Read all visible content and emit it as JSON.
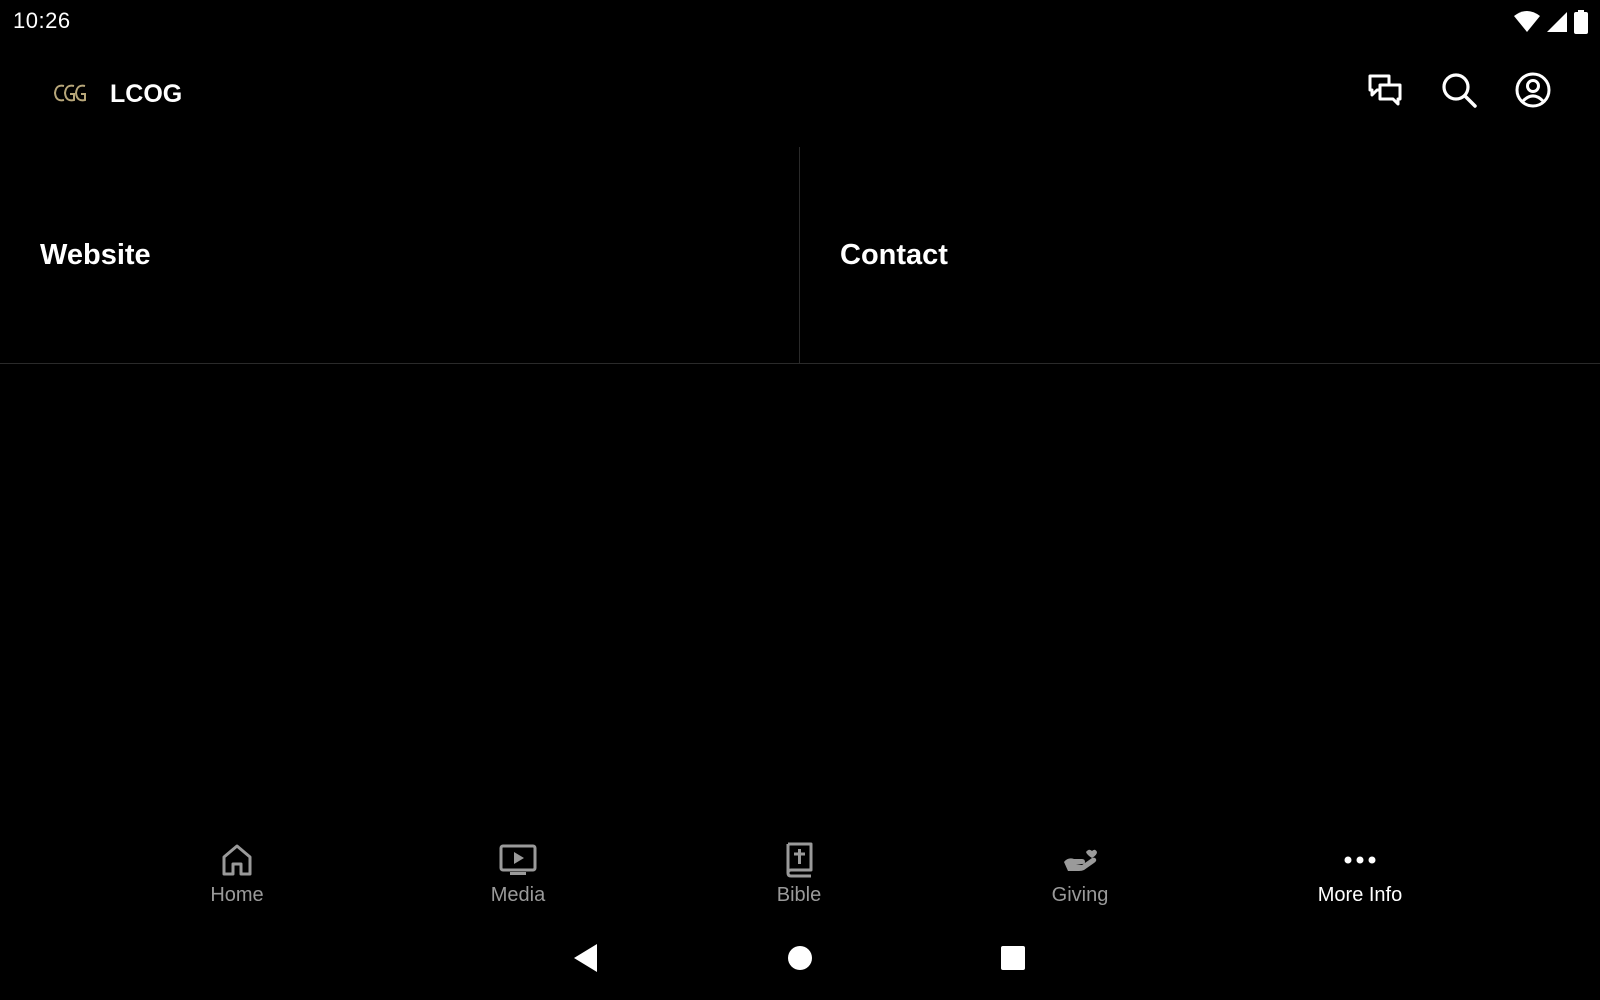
{
  "status_bar": {
    "time": "10:26",
    "icons": [
      "wifi-icon",
      "cell-signal-icon",
      "battery-icon"
    ]
  },
  "app_bar": {
    "logo_icon": "lcog-logo",
    "title": "LCOG",
    "actions": [
      {
        "name": "chat-icon"
      },
      {
        "name": "search-icon"
      },
      {
        "name": "account-icon"
      }
    ]
  },
  "tiles": [
    {
      "label": "Website"
    },
    {
      "label": "Contact"
    }
  ],
  "bottom_nav": {
    "items": [
      {
        "label": "Home",
        "icon": "home-icon",
        "active": false
      },
      {
        "label": "Media",
        "icon": "media-icon",
        "active": false
      },
      {
        "label": "Bible",
        "icon": "bible-icon",
        "active": false
      },
      {
        "label": "Giving",
        "icon": "giving-icon",
        "active": false
      },
      {
        "label": "More Info",
        "icon": "more-icon",
        "active": true
      }
    ]
  },
  "system_nav": {
    "buttons": [
      "back-icon",
      "home-circle-icon",
      "recents-icon"
    ]
  },
  "colors": {
    "background": "#000000",
    "text_primary": "#ffffff",
    "text_inactive": "#9a9a9a",
    "divider": "#2a2a2a",
    "logo_gold": "#b8a77a"
  }
}
